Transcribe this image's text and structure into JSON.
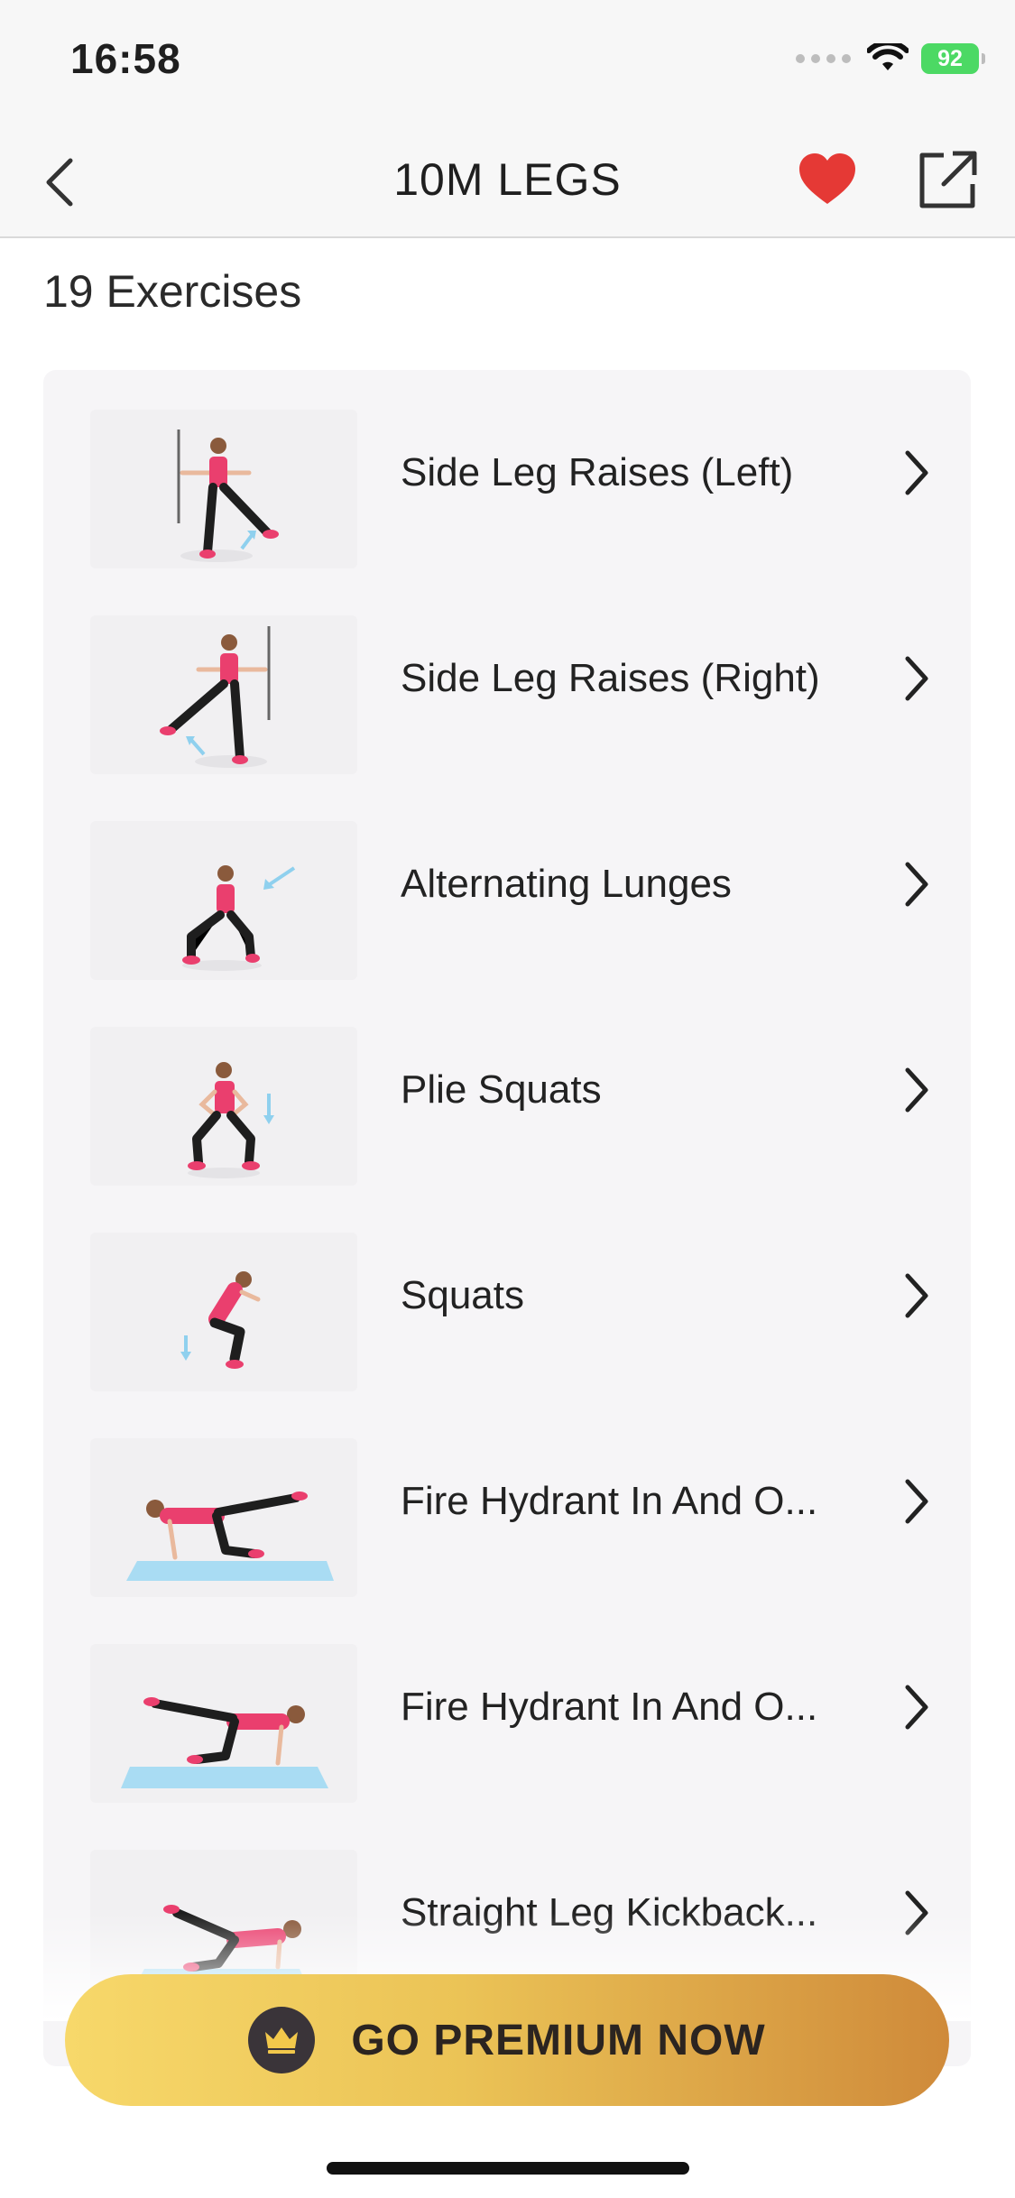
{
  "status_bar": {
    "time": "16:58",
    "battery": "92"
  },
  "header": {
    "title": "10M LEGS"
  },
  "summary": {
    "count_label": "19 Exercises"
  },
  "exercises": [
    {
      "label": "Side Leg Raises (Left)"
    },
    {
      "label": "Side Leg Raises (Right)"
    },
    {
      "label": "Alternating Lunges"
    },
    {
      "label": "Plie Squats"
    },
    {
      "label": "Squats"
    },
    {
      "label": "Fire Hydrant In And O..."
    },
    {
      "label": "Fire Hydrant In And O..."
    },
    {
      "label": "Straight Leg Kickback..."
    }
  ],
  "premium": {
    "label": "GO PREMIUM NOW"
  },
  "colors": {
    "accent_pink": "#ea3f6e",
    "heart": "#e53935",
    "mat": "#a9dcf3"
  }
}
